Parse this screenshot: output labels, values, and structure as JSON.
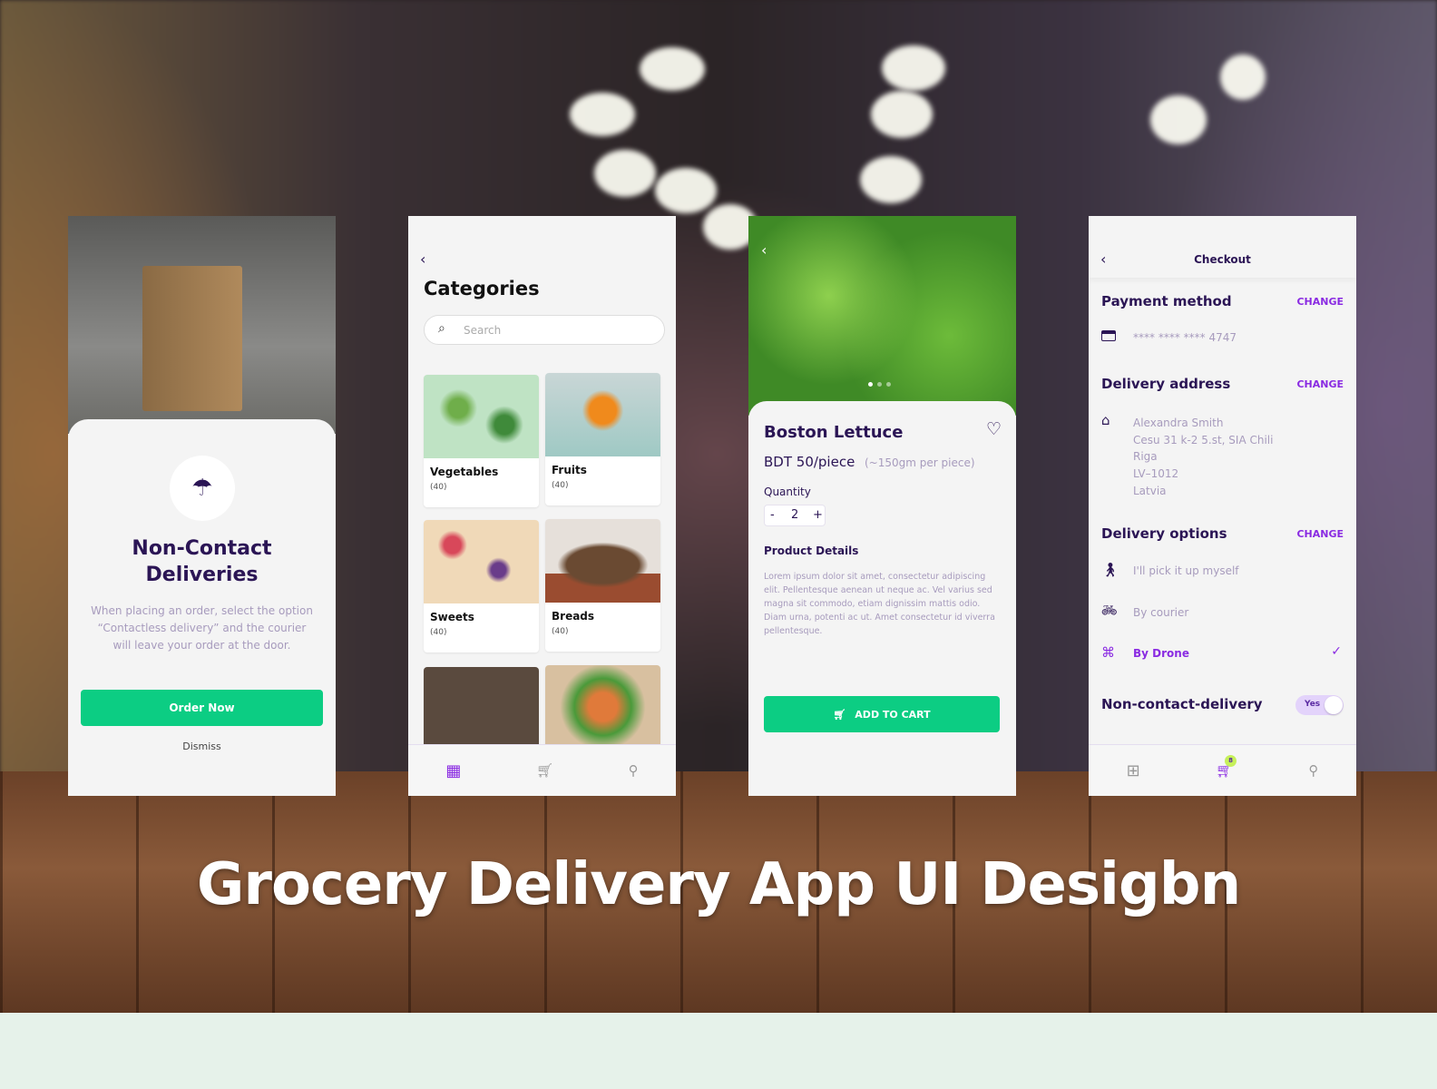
{
  "headline": "Grocery Delivery App UI Desigbn",
  "colors": {
    "accent_green": "#0ccd83",
    "primary_dark": "#2b1555",
    "accent_purple": "#8a2be2",
    "badge": "#c6f05a"
  },
  "onboarding": {
    "title_line1": "Non-Contact",
    "title_line2": "Deliveries",
    "description": "When placing an order, select the option “Contactless delivery” and the courier will leave your order at the door.",
    "order_button": "Order Now",
    "dismiss": "Dismiss",
    "icon": "parachute-icon"
  },
  "categories": {
    "title": "Categories",
    "search_placeholder": "Search",
    "items": [
      {
        "name": "Vegetables",
        "count": "(40)"
      },
      {
        "name": "Fruits",
        "count": "(40)"
      },
      {
        "name": "Sweets",
        "count": "(40)"
      },
      {
        "name": "Breads",
        "count": "(40)"
      }
    ]
  },
  "product": {
    "name": "Boston Lettuce",
    "price": "BDT 50/piece",
    "weight": "(~150gm per piece)",
    "quantity_label": "Quantity",
    "quantity": "2",
    "minus": "-",
    "plus": "+",
    "details_title": "Product Details",
    "details": "Lorem ipsum dolor sit amet, consectetur adipiscing elit. Pellentesque aenean ut neque ac. Vel varius sed magna sit commodo, etiam dignissim mattis odio. Diam urna, potenti ac ut. Amet consectetur id viverra pellentesque.",
    "add_to_cart": "ADD TO CART",
    "image_page": 1,
    "image_pages": 3
  },
  "checkout": {
    "title": "Checkout",
    "payment_title": "Payment method",
    "change": "CHANGE",
    "card": "**** **** **** 4747",
    "address_title": "Delivery address",
    "address": [
      "Alexandra Smith",
      "Cesu 31 k-2 5.st, SIA Chili",
      "Riga",
      "LV–1012",
      "Latvia"
    ],
    "options_title": "Delivery options",
    "options": [
      {
        "label": "I'll pick it up myself",
        "selected": false
      },
      {
        "label": "By courier",
        "selected": false
      },
      {
        "label": "By Drone",
        "selected": true
      }
    ],
    "noncontact_title": "Non-contact-delivery",
    "toggle": "Yes",
    "toggle_on": true,
    "cart_badge": "8"
  }
}
